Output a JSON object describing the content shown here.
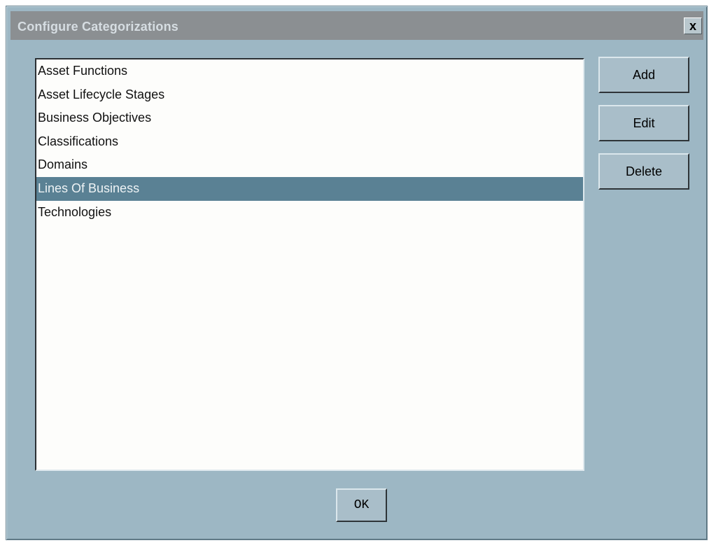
{
  "window": {
    "title": "Configure Categorizations",
    "close_label": "x"
  },
  "list": {
    "items": [
      {
        "label": "Asset Functions",
        "selected": false
      },
      {
        "label": "Asset Lifecycle Stages",
        "selected": false
      },
      {
        "label": "Business Objectives",
        "selected": false
      },
      {
        "label": "Classifications",
        "selected": false
      },
      {
        "label": "Domains",
        "selected": false
      },
      {
        "label": "Lines Of Business",
        "selected": true
      },
      {
        "label": "Technologies",
        "selected": false
      }
    ]
  },
  "buttons": {
    "add": "Add",
    "edit": "Edit",
    "delete": "Delete",
    "ok": "OK"
  },
  "colors": {
    "dialog_bg": "#9db7c4",
    "titlebar_bg": "#8b8f92",
    "selection_bg": "#5a8194",
    "list_bg": "#fdfdfb"
  }
}
